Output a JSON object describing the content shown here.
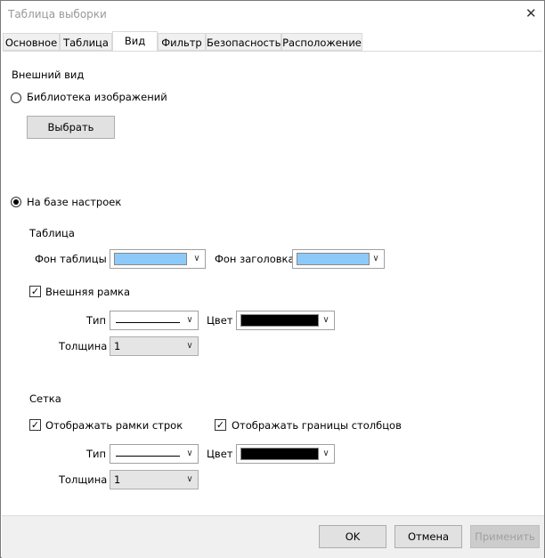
{
  "window": {
    "title": "Таблица выборки",
    "close_glyph": "✕"
  },
  "tabs": [
    "Основное",
    "Таблица",
    "Вид",
    "Фильтр",
    "Безопасность",
    "Расположение"
  ],
  "active_tab": "Вид",
  "appearance": {
    "heading": "Внешний вид",
    "radio_library": "Библиотека изображений",
    "choose_button": "Выбрать",
    "radio_settings": "На базе настроек"
  },
  "table_section": {
    "heading": "Таблица",
    "bg_label": "Фон таблицы",
    "bg_color": "#8dcaf9",
    "header_bg_label": "Фон заголовка",
    "header_bg_color": "#8dcaf9",
    "outer_frame_label": "Внешняя рамка",
    "outer_frame_checked": true,
    "type_label": "Тип",
    "color_label": "Цвет",
    "line_color": "#000000",
    "thickness_label": "Толщина",
    "thickness_value": "1"
  },
  "grid_section": {
    "heading": "Сетка",
    "row_frames_label": "Отображать рамки строк",
    "row_frames_checked": true,
    "col_borders_label": "Отображать границы столбцов",
    "col_borders_checked": true,
    "type_label": "Тип",
    "color_label": "Цвет",
    "line_color": "#000000",
    "thickness_label": "Толщина",
    "thickness_value": "1"
  },
  "footer": {
    "ok": "OK",
    "cancel": "Отмена",
    "apply": "Применить"
  },
  "glyphs": {
    "dropdown_arrow": "∨",
    "check_mark": "✓"
  }
}
